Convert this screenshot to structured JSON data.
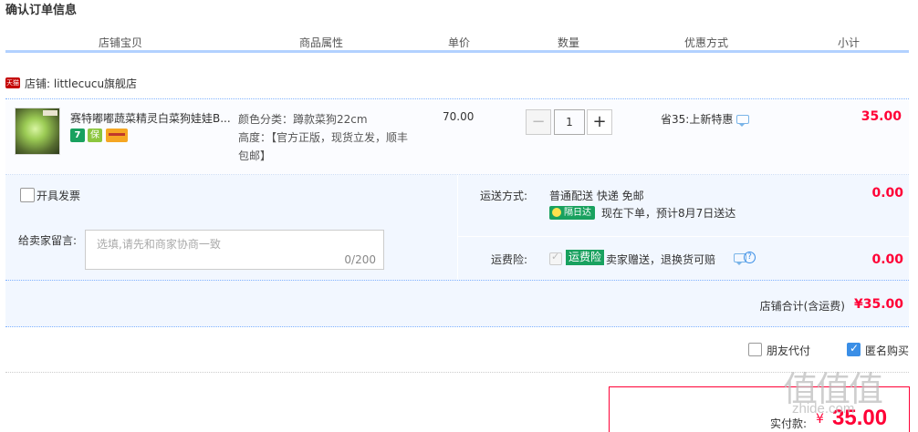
{
  "page": {
    "title": "确认订单信息"
  },
  "table_header": [
    "店铺宝贝",
    "商品属性",
    "单价",
    "数量",
    "优惠方式",
    "小计"
  ],
  "shop": {
    "badge": "天猫",
    "name": "店铺: littlecucu旗舰店"
  },
  "item": {
    "name": "赛特嘟嘟蔬菜精灵白菜狗娃娃B...",
    "service_badges": [
      "7",
      "保",
      "卡"
    ],
    "attr_line1": "颜色分类：蹲款菜狗22cm",
    "attr_line2": "高度：【官方正版，现货立发，顺丰包邮】",
    "unit_price": "70.00",
    "quantity": "1",
    "qty_minus": "−",
    "qty_plus": "+",
    "promo": "省35:上新特惠",
    "subtotal": "35.00"
  },
  "options": {
    "invoice_label": "开具发票",
    "message_label": "给卖家留言:",
    "message_placeholder": "选填,请先和商家协商一致",
    "message_count": "0/200"
  },
  "shipping": {
    "label": "运送方式:",
    "method": "普通配送 快递 免邮",
    "badge": "隔日达",
    "eta": "现在下单，预计8月7日送达",
    "fee": "0.00"
  },
  "insurance": {
    "label": "运费险:",
    "badge": "运费险",
    "text": "卖家赠送，退换货可赔",
    "help": "?",
    "fee": "0.00"
  },
  "shop_total": {
    "label": "店铺合计(含运费)",
    "value": "¥35.00"
  },
  "footer_options": {
    "friend_pay": "朋友代付",
    "anonymous": "匿名购买"
  },
  "payment": {
    "label": "实付款:",
    "currency": "¥",
    "amount": "35.00"
  },
  "watermark": {
    "logo": "值值值",
    "url": "zhide.com"
  },
  "colors": {
    "accent_red": "#ff0036",
    "header_line": "#b2d1ff",
    "panel_bg": "#f2f7ff",
    "green": "#19a15f"
  }
}
